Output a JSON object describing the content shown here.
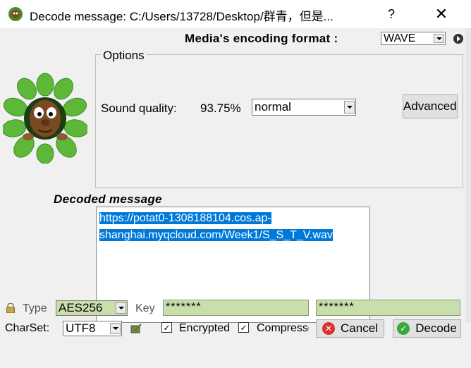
{
  "window": {
    "title": "Decode message: C:/Users/13728/Desktop/群青，但是...",
    "help_label": "?",
    "close_label": "✕"
  },
  "encoding": {
    "label": "Media's encoding format :",
    "selected": "WAVE"
  },
  "options": {
    "legend": "Options",
    "sound_quality_label": "Sound quality:",
    "sound_quality_value": "93.75%",
    "quality_selected": "normal",
    "advanced_label": "Advanced"
  },
  "decoded": {
    "label": "Decoded message",
    "line1": "https://potat0-1308188104.cos.ap-",
    "line2": "shanghai.myqcloud.com/Week1/S_S_T_V.wav"
  },
  "crypto": {
    "type_label": "Type",
    "type_selected": "AES256",
    "key_label": "Key",
    "key_value": "*******",
    "key_confirm_value": "*******"
  },
  "bottom": {
    "charset_label": "CharSet:",
    "charset_selected": "UTF8",
    "encrypted_label": "Encrypted",
    "encrypted_checked": "✓",
    "compressed_label": "Compressed",
    "compressed_checked": "✓",
    "cancel_label": "Cancel",
    "decode_label": "Decode"
  },
  "colors": {
    "selection": "#0078d7",
    "key_field_bg": "#c9deab"
  }
}
